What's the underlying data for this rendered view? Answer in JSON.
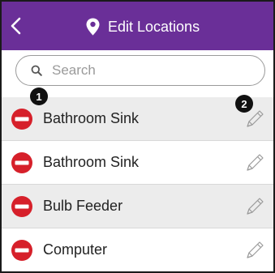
{
  "header": {
    "title": "Edit Locations",
    "color": "#6a2f98"
  },
  "search": {
    "placeholder": "Search",
    "value": ""
  },
  "badges": {
    "first": "1",
    "second": "2"
  },
  "list": {
    "items": [
      {
        "label": "Bathroom Sink"
      },
      {
        "label": "Bathroom Sink"
      },
      {
        "label": "Bulb Feeder"
      },
      {
        "label": "Computer"
      }
    ]
  },
  "icons": {
    "back": "chevron-left-icon",
    "header": "location-pin-icon",
    "search": "search-icon",
    "delete": "delete-minus-icon",
    "edit": "pencil-icon"
  },
  "colors": {
    "delete_red": "#d6202a",
    "shaded_row": "#ececec",
    "badge": "#111111"
  }
}
